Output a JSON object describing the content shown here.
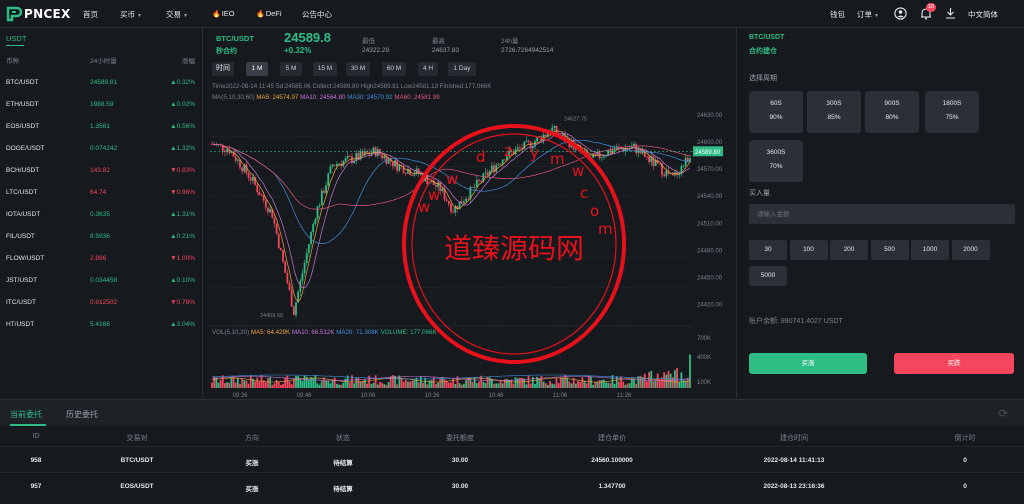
{
  "brand": {
    "name": "PNCEX"
  },
  "nav": {
    "home": "首页",
    "buy": "买币",
    "trade": "交易",
    "ieo": "IEO",
    "defi": "DeFi",
    "notice": "公告中心",
    "wallet": "钱包",
    "orders": "订单",
    "language": "中文简体",
    "notification_count": "10"
  },
  "market": {
    "tab": "USDT",
    "col_coin": "币种",
    "col_volume": "24小时量",
    "col_change": "涨幅",
    "rows": [
      {
        "pair": "BTC/USDT",
        "price": "24589.81",
        "change": "▲0.32%",
        "up": true
      },
      {
        "pair": "ETH/USDT",
        "price": "1988.59",
        "change": "▲0.02%",
        "up": true
      },
      {
        "pair": "EOS/USDT",
        "price": "1.3561",
        "change": "▲0.56%",
        "up": true
      },
      {
        "pair": "DOGE/USDT",
        "price": "0.074242",
        "change": "▲1.32%",
        "up": true
      },
      {
        "pair": "BCH/USDT",
        "price": "143.82",
        "change": "▼0.83%",
        "up": false
      },
      {
        "pair": "LTC/USDT",
        "price": "64.74",
        "change": "▼0.96%",
        "up": false
      },
      {
        "pair": "IOTA/USDT",
        "price": "0.3635",
        "change": "▲1.31%",
        "up": true
      },
      {
        "pair": "FIL/USDT",
        "price": "8.5936",
        "change": "▲0.21%",
        "up": true
      },
      {
        "pair": "FLOW/USDT",
        "price": "2.896",
        "change": "▼1.00%",
        "up": false
      },
      {
        "pair": "JST/USDT",
        "price": "0.034458",
        "change": "▲0.10%",
        "up": true
      },
      {
        "pair": "ITC/USDT",
        "price": "0.912502",
        "change": "▼0.79%",
        "up": false
      },
      {
        "pair": "HT/USDT",
        "price": "5.4168",
        "change": "▲3.04%",
        "up": true
      }
    ]
  },
  "pair_header": {
    "pair": "BTC/USDT",
    "subtitle": "秒合约",
    "price": "24589.8",
    "change": "+0.32%",
    "low_label": "最低",
    "low_value": "24322.29",
    "high_label": "最高",
    "high_value": "24637.83",
    "vol_label": "24h量",
    "vol_value": "2726.7264942514"
  },
  "timeframes": {
    "label": "时间",
    "options": [
      "1 M",
      "5 M",
      "15 M",
      "30 M",
      "60 M",
      "4 H",
      "1 Day"
    ],
    "active": "1 M"
  },
  "chart_data": {
    "type": "candlestick",
    "info_line": "Time2022-08-14 11:45   Sd:24585.06   Collect:24589.80   High24589.81   Low24581.13   Finished:177.066K",
    "ma_line": {
      "label": "MA(5,10,30,60)",
      "items": [
        {
          "name": "MA5",
          "value": "24574.97",
          "color": "#f0a33a"
        },
        {
          "name": "MA10",
          "value": "24564.80",
          "color": "#c673d6"
        },
        {
          "name": "MA30",
          "value": "24570.92",
          "color": "#3f8fdc"
        },
        {
          "name": "MA60",
          "value": "24581.99",
          "color": "#e0567a"
        }
      ]
    },
    "vol_line": {
      "label": "VOL(5,10,20)",
      "items": [
        {
          "name": "MA5",
          "value": "64.429K",
          "color": "#f0a33a"
        },
        {
          "name": "MA10",
          "value": "66.512K",
          "color": "#c673d6"
        },
        {
          "name": "MA20",
          "value": "71.308K",
          "color": "#3f8fdc"
        },
        {
          "name": "VOLUME",
          "value": "177.066K",
          "color": "#2ebd85"
        }
      ]
    },
    "price_ticks": [
      "24630.00",
      "24600.00",
      "24570.00",
      "24540.00",
      "24510.00",
      "24480.00",
      "24450.00",
      "24420.00"
    ],
    "vol_ticks": [
      "700K",
      "400K",
      "100K"
    ],
    "time_ticks": [
      "09:26",
      "09:46",
      "10:06",
      "10:26",
      "10:46",
      "11:06",
      "11:26"
    ],
    "current_price": "24589.80",
    "max_label": "24627.75",
    "min_label": "24409.69",
    "ylim": [
      24405,
      24640
    ]
  },
  "trade": {
    "pair": "BTC/USDT",
    "subtitle": "合约建仓",
    "period_label": "选择周期",
    "periods": [
      {
        "time": "60S",
        "rate": "90%"
      },
      {
        "time": "300S",
        "rate": "85%"
      },
      {
        "time": "900S",
        "rate": "80%"
      },
      {
        "time": "1800S",
        "rate": "75%"
      },
      {
        "time": "3600S",
        "rate": "70%"
      }
    ],
    "amount_label": "买入量",
    "amount_placeholder": "请输入金额",
    "quick_amounts": [
      "30",
      "100",
      "200",
      "500",
      "1000",
      "2000",
      "5000"
    ],
    "balance_label": "账户余额:",
    "balance_value": "890741.4027 USDT",
    "buy_up": "买涨",
    "buy_down": "买跌"
  },
  "orders": {
    "tab_current": "当前委托",
    "tab_history": "历史委托",
    "headers": [
      "ID",
      "交易对",
      "方向",
      "状态",
      "委托额度",
      "建仓单价",
      "建仓时间",
      "倒计时"
    ],
    "rows": [
      {
        "id": "958",
        "pair": "BTC/USDT",
        "direction": "买涨",
        "status": "待结算",
        "amount": "30.00",
        "price": "24560.100000",
        "time": "2022-08-14 11:41:13",
        "countdown": "0"
      },
      {
        "id": "957",
        "pair": "EOS/USDT",
        "direction": "买涨",
        "status": "待结算",
        "amount": "30.00",
        "price": "1.347700",
        "time": "2022-08-13 23:16:36",
        "countdown": "0"
      }
    ]
  },
  "watermark": {
    "title": "道臻源码网",
    "url_top": "wwwdzymw",
    "url_side": "com"
  }
}
